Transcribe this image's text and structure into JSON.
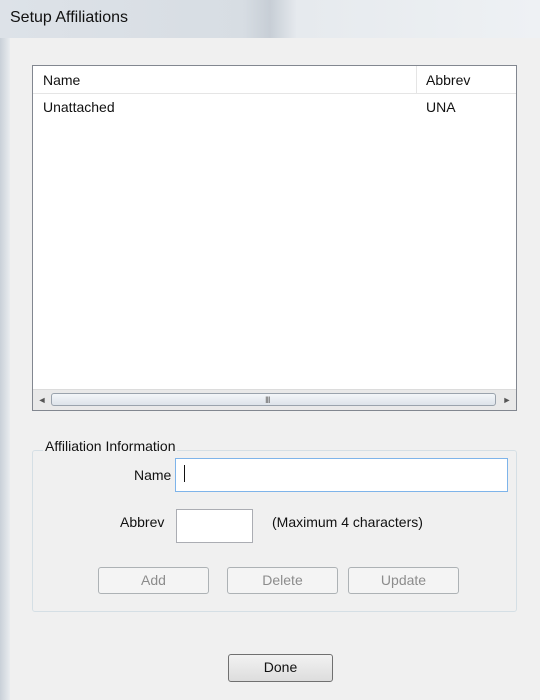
{
  "window": {
    "title": "Setup Affiliations"
  },
  "list": {
    "columns": [
      "Name",
      "Abbrev"
    ],
    "rows": [
      {
        "name": "Unattached",
        "abbrev": "UNA"
      }
    ],
    "scrollbar": {
      "left_arrow": "◄",
      "right_arrow": "►",
      "grip": "III"
    }
  },
  "affiliation_info": {
    "legend": "Affiliation Information",
    "name_label": "Name",
    "name_value": "",
    "abbrev_label": "Abbrev",
    "abbrev_value": "",
    "abbrev_hint": "(Maximum 4 characters)"
  },
  "buttons": {
    "add": "Add",
    "delete": "Delete",
    "update": "Update",
    "done": "Done"
  }
}
